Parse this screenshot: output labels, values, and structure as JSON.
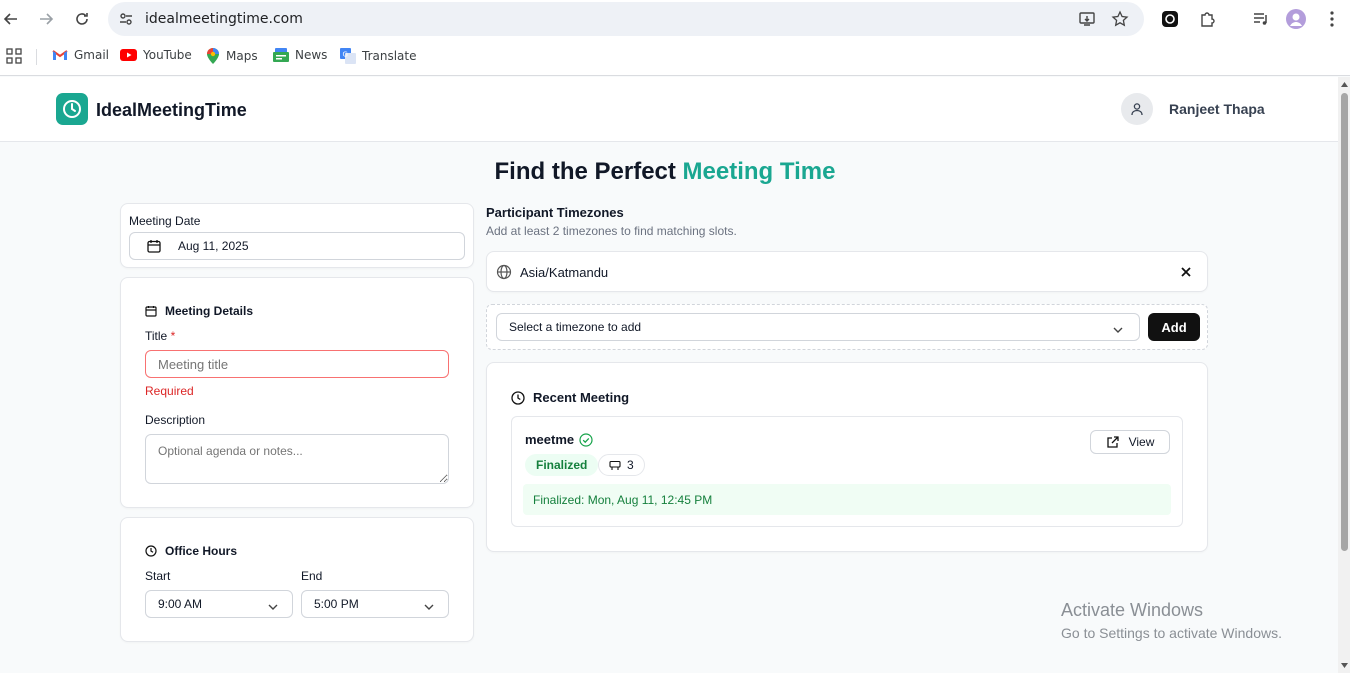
{
  "browser": {
    "url": "idealmeetingtime.com",
    "bookmarks": [
      "Gmail",
      "YouTube",
      "Maps",
      "News",
      "Translate"
    ]
  },
  "header": {
    "brand": "IdealMeetingTime",
    "username": "Ranjeet Thapa"
  },
  "page": {
    "title_main": "Find the Perfect ",
    "title_accent": "Meeting Time"
  },
  "meeting_date": {
    "label": "Meeting Date",
    "value": "Aug 11, 2025"
  },
  "meeting_details": {
    "heading": "Meeting Details",
    "title_label": "Title",
    "required_mark": "*",
    "title_placeholder": "Meeting title",
    "required_msg": "Required",
    "description_label": "Description",
    "description_placeholder": "Optional agenda or notes..."
  },
  "office_hours": {
    "heading": "Office Hours",
    "start_label": "Start",
    "start_value": "9:00 AM",
    "end_label": "End",
    "end_value": "5:00 PM"
  },
  "timezones": {
    "heading": "Participant Timezones",
    "subtitle": "Add at least 2 timezones to find matching slots.",
    "items": [
      "Asia/Katmandu"
    ],
    "select_placeholder": "Select a timezone to add",
    "add_label": "Add"
  },
  "recent": {
    "heading": "Recent Meeting",
    "name": "meetme",
    "status": "Finalized",
    "participants": "3",
    "view_label": "View",
    "finalized_text": "Finalized: Mon, Aug 11, 12:45 PM"
  },
  "watermark": {
    "line1": "Activate Windows",
    "line2": "Go to Settings to activate Windows."
  },
  "colors": {
    "accent": "#1aa791",
    "error": "#dc2626",
    "success": "#16a34a"
  }
}
